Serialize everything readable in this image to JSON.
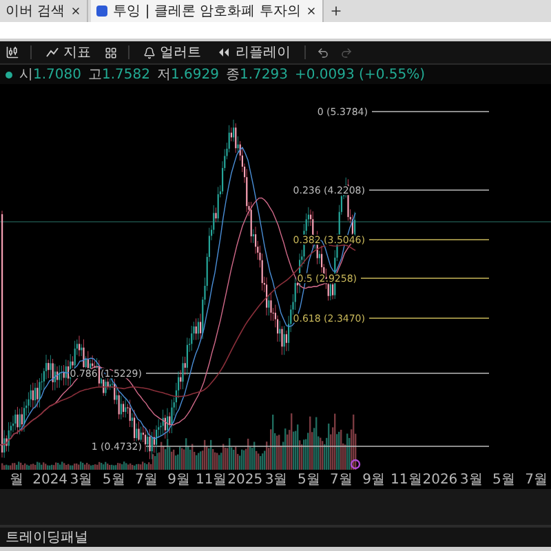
{
  "browser": {
    "tabs": [
      {
        "title": "이버 검색",
        "selected": false
      },
      {
        "title": "투잉 | 클레론 암호화폐 투자의",
        "selected": true
      }
    ]
  },
  "toolbar": {
    "buttons": [
      "지표",
      "얼러트",
      "리플레이"
    ]
  },
  "legend": {
    "values": [
      {
        "label": "시",
        "value": "1.7080"
      },
      {
        "label": "고",
        "value": "1.7582"
      },
      {
        "label": "저",
        "value": "1.6929"
      },
      {
        "label": "종",
        "value": "1.7293"
      }
    ],
    "change": "+0.0093 (+0.55%)"
  },
  "fib_levels": [
    {
      "label": "0 (5.3784)",
      "color": "#bdbdbd"
    },
    {
      "label": "0.236 (4.2208)",
      "color": "#bdbdbd"
    },
    {
      "label": "0.382 (3.5046)",
      "color": "#c9b85a"
    },
    {
      "label": "0.5 (2.9258)",
      "color": "#c9b85a"
    },
    {
      "label": "0.618 (2.3470)",
      "color": "#c9b85a"
    },
    {
      "label": "0.786 (1.5229)",
      "color": "#bdbdbd"
    },
    {
      "label": "1 (0.4732)",
      "color": "#bdbdbd"
    }
  ],
  "time_axis": [
    "월",
    "2024",
    "3월",
    "5월",
    "7월",
    "9월",
    "11월",
    "2025",
    "3월",
    "5월",
    "7월",
    "9월",
    "11월",
    "2026",
    "3월",
    "5월",
    "7월"
  ],
  "bottom_panel": {
    "title": "트레이딩패널"
  }
}
